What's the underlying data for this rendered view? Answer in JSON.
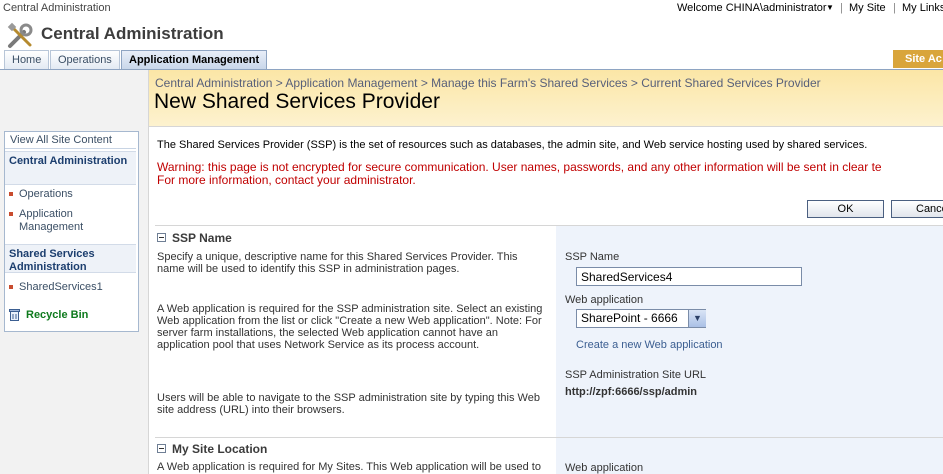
{
  "topbar": {
    "site_name": "Central Administration",
    "welcome": "Welcome CHINA\\administrator",
    "separator": "|",
    "my_site": "My Site",
    "my_links": "My Links"
  },
  "header": {
    "title": "Central Administration",
    "site_actions": "Site Ac"
  },
  "tabs": [
    {
      "label": "Home"
    },
    {
      "label": "Operations"
    },
    {
      "label": "Application Management"
    }
  ],
  "nav": {
    "view_all": "View All Site Content",
    "central_admin": "Central Administration",
    "items": [
      "Operations",
      "Application Management"
    ],
    "shared_services_admin": "Shared Services Administration",
    "shared_items": [
      "SharedServices1"
    ],
    "recycle_bin": "Recycle Bin"
  },
  "breadcrumb": "Central Administration > Application Management > Manage this Farm's Shared Services > Current Shared Services Provider",
  "page": {
    "title": "New Shared Services Provider",
    "description": "The Shared Services Provider (SSP) is the set of resources such as databases, the admin site, and Web service hosting used by shared services.",
    "warning1": "Warning: this page is not encrypted for secure communication. User names, passwords, and any other information will be sent in clear te",
    "warning2": "For more information, contact your administrator.",
    "ok": "OK",
    "cancel": "Cance"
  },
  "section1": {
    "title": "SSP Name",
    "p1": "Specify a unique, descriptive name for this Shared Services Provider. This name will be used to identify this SSP in administration pages.",
    "p2": "A Web application is required for the SSP administration site. Select an existing Web application from the list or click \"Create a new Web application\". Note: For server farm installations, the selected Web application cannot have an application pool that uses Network Service as its process account.",
    "p3": "Users will be able to navigate to the SSP administration site by typing this Web site address (URL) into their browsers.",
    "ssp_name_label": "SSP Name",
    "ssp_name_value": "SharedServices4",
    "webapp_label": "Web application",
    "webapp_value": "SharePoint - 6666",
    "create_link": "Create a new Web application",
    "url_label": "SSP Administration Site URL",
    "url_value": "http://zpf:6666/ssp/admin"
  },
  "section2": {
    "title": "My Site Location",
    "p1": "A Web application is required for My Sites. This Web application will be used to",
    "webapp_label": "Web application"
  },
  "colors": {
    "title_band": "#fbe6a6",
    "warning": "#c00000",
    "link": "#3b5e91",
    "right_panel": "#eef3fb"
  }
}
